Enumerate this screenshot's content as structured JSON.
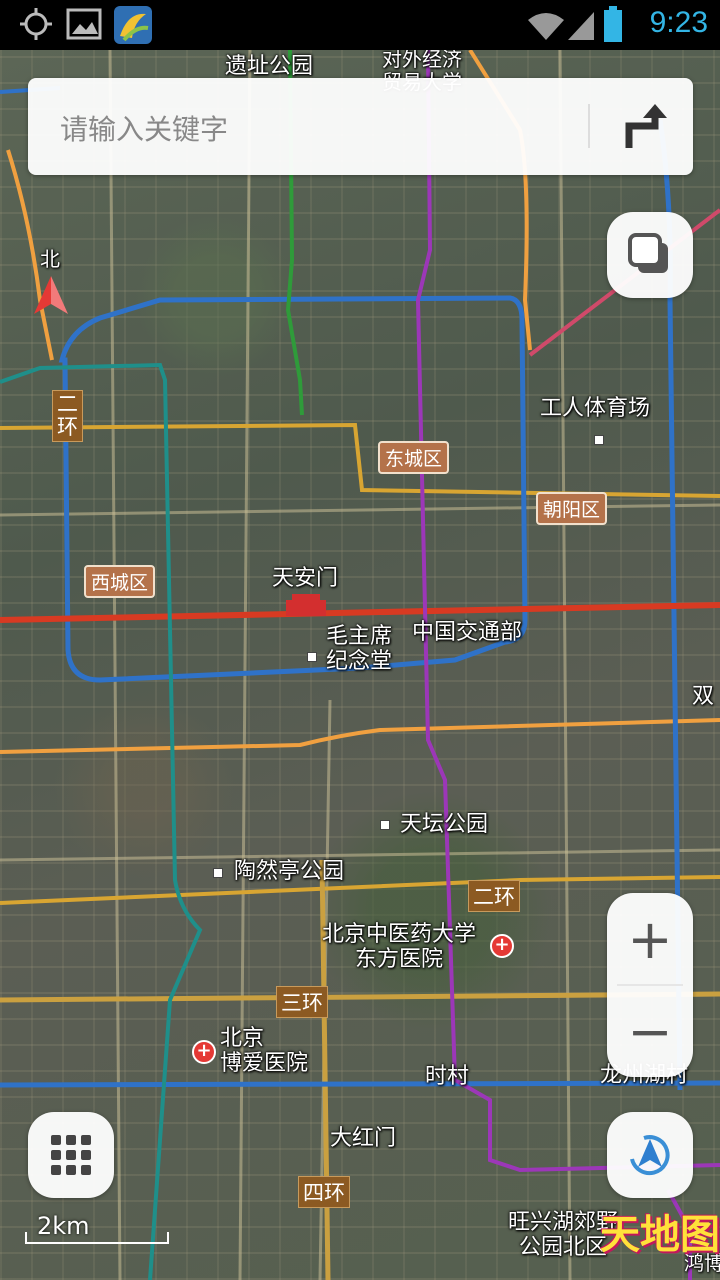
{
  "status_bar": {
    "time": "9:23"
  },
  "search": {
    "placeholder": "请输入关键字"
  },
  "compass": {
    "label": "北"
  },
  "districts": {
    "dongcheng": "东城区",
    "xicheng": "西城区",
    "chaoyang": "朝阳区"
  },
  "rings": {
    "second_left": "二\n环",
    "second_right": "二环",
    "third": "三环",
    "fourth": "四环"
  },
  "places": {
    "top_park": "遗址公园",
    "top_uni": "对外经济\n贸易大学",
    "workers_stadium": "工人体育场",
    "tiananmen": "天安门",
    "mausoleum": "毛主席\n纪念堂",
    "ministry": "中国交通部",
    "tiantan": "天坛公园",
    "taoranting": "陶然亭公园",
    "tcm_uni": "北京中医药大学\n东方医院",
    "boai": "北京\n博爱医院",
    "shicun": "时村",
    "dahongmen": "大红门",
    "wangxing": "旺兴湖郊野\n公园北区",
    "right_edge": "双",
    "right_bottom": "龙州湖村",
    "right_bottom2": "鸿博"
  },
  "scale": {
    "label": "2km"
  },
  "zoom": {
    "in": "+",
    "out": "−"
  },
  "logo": {
    "text": "天地图"
  },
  "colors": {
    "accent": "#33b5e5",
    "district_badge": "#b4724a",
    "ring_badge": "#8c5a22"
  }
}
